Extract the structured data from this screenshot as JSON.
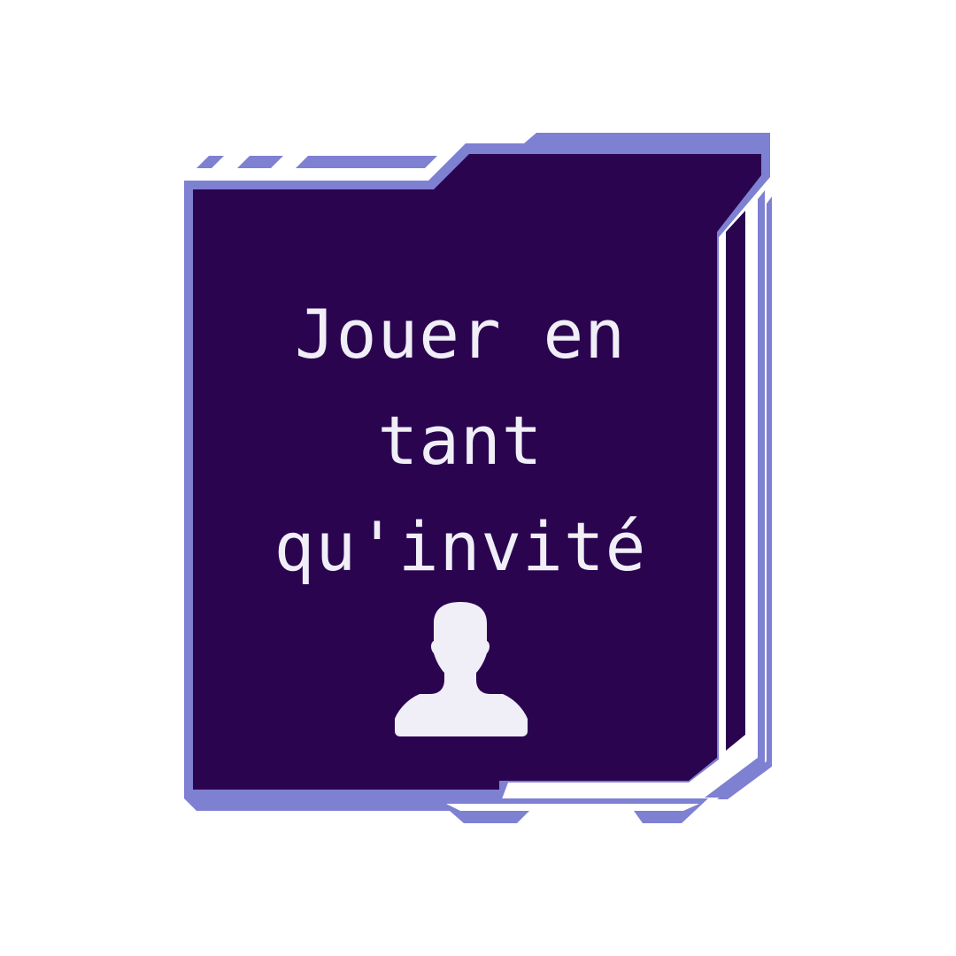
{
  "guest_button": {
    "label": "Jouer en\ntant\nqu'invité",
    "icon": "user-icon"
  },
  "colors": {
    "frame": "#7e80d2",
    "panel": "#2b0450",
    "text": "#f0eef6",
    "background": "#ffffff"
  }
}
